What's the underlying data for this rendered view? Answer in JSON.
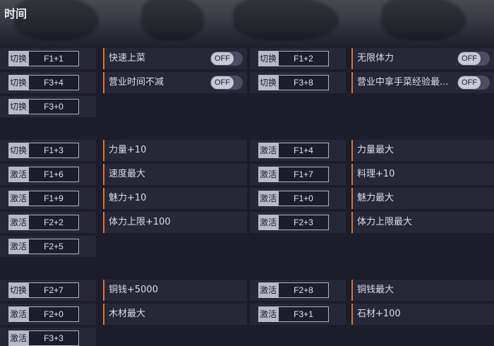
{
  "header": {
    "title": "时间"
  },
  "sections": {
    "time": {
      "rows": [
        {
          "left_mode": "切换",
          "left_key": "F1+1",
          "left_label": "快速上菜",
          "left_toggle": "OFF",
          "right_mode": "切换",
          "right_key": "F1+2",
          "right_label": "无限体力",
          "right_toggle": "OFF"
        },
        {
          "left_mode": "切换",
          "left_key": "F3+4",
          "left_label": "营业时间不减",
          "left_toggle": "OFF",
          "right_mode": "切换",
          "right_key": "F3+8",
          "right_label": "营业中拿手菜经验最...",
          "right_toggle": "OFF"
        },
        {
          "left_mode": "切换",
          "left_key": "F3+0"
        }
      ]
    },
    "attributes": {
      "rows": [
        {
          "left_mode": "切换",
          "left_key": "F1+3",
          "left_label": "力量+10",
          "right_mode": "激活",
          "right_key": "F1+4",
          "right_label": "力量最大"
        },
        {
          "left_mode": "激活",
          "left_key": "F1+6",
          "left_label": "速度最大",
          "right_mode": "激活",
          "right_key": "F1+7",
          "right_label": "料理+10"
        },
        {
          "left_mode": "激活",
          "left_key": "F1+9",
          "left_label": "魅力+10",
          "right_mode": "激活",
          "right_key": "F1+0",
          "right_label": "魅力最大"
        },
        {
          "left_mode": "激活",
          "left_key": "F2+2",
          "left_label": "体力上限+100",
          "right_mode": "激活",
          "right_key": "F2+3",
          "right_label": "体力上限最大"
        },
        {
          "left_mode": "激活",
          "left_key": "F2+5"
        }
      ]
    },
    "resources": {
      "rows": [
        {
          "left_mode": "切换",
          "left_key": "F2+7",
          "left_label": "铜钱+5000",
          "right_mode": "激活",
          "right_key": "F2+8",
          "right_label": "铜钱最大"
        },
        {
          "left_mode": "激活",
          "left_key": "F2+0",
          "left_label": "木材最大",
          "right_mode": "激活",
          "right_key": "F3+1",
          "right_label": "石材+100"
        },
        {
          "left_mode": "激活",
          "left_key": "F3+3"
        }
      ]
    }
  }
}
